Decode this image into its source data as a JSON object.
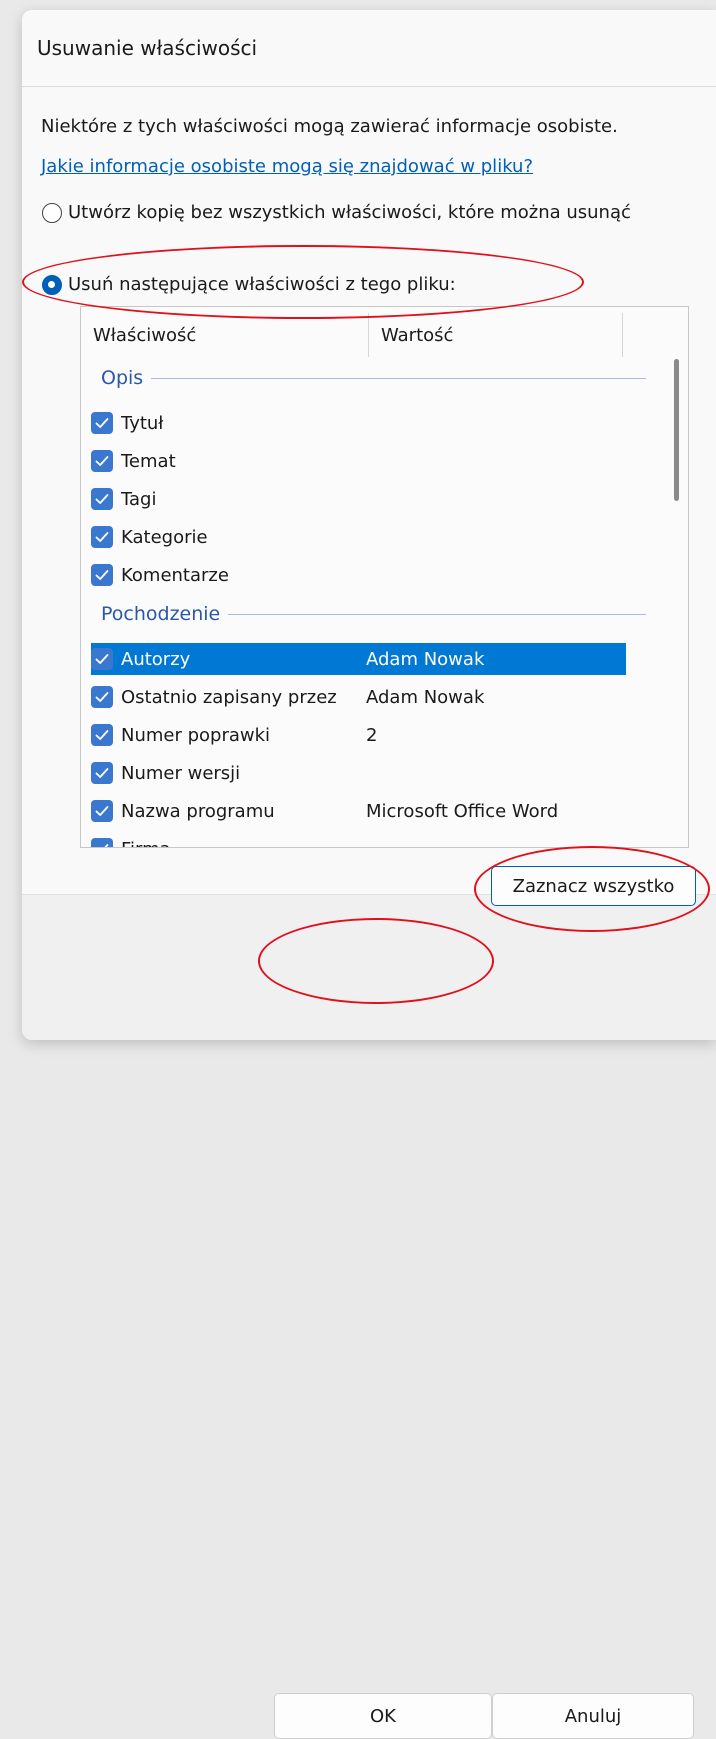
{
  "dialog": {
    "title": "Usuwanie właściwości",
    "info_text": "Niektóre z tych właściwości mogą zawierać informacje osobiste.",
    "link_text": "Jakie informacje osobiste mogą się znajdować w pliku?",
    "option_copy": "Utwórz kopię bez wszystkich właściwości, które można usunąć",
    "option_remove": "Usuń następujące właściwości z tego pliku:",
    "selected_option": "remove"
  },
  "list": {
    "col_property": "Właściwość",
    "col_value": "Wartość",
    "groups": [
      {
        "name": "Opis",
        "items": [
          {
            "label": "Tytuł",
            "value": "",
            "checked": true
          },
          {
            "label": "Temat",
            "value": "",
            "checked": true
          },
          {
            "label": "Tagi",
            "value": "",
            "checked": true
          },
          {
            "label": "Kategorie",
            "value": "",
            "checked": true
          },
          {
            "label": "Komentarze",
            "value": "",
            "checked": true
          }
        ]
      },
      {
        "name": "Pochodzenie",
        "items": [
          {
            "label": "Autorzy",
            "value": "Adam Nowak",
            "checked": true,
            "selected": true
          },
          {
            "label": "Ostatnio zapisany przez",
            "value": "Adam Nowak",
            "checked": true
          },
          {
            "label": "Numer poprawki",
            "value": "2",
            "checked": true
          },
          {
            "label": "Numer wersji",
            "value": "",
            "checked": true
          },
          {
            "label": "Nazwa programu",
            "value": "Microsoft Office Word",
            "checked": true
          },
          {
            "label": "Firma",
            "value": "",
            "checked": true
          }
        ]
      }
    ]
  },
  "buttons": {
    "select_all": "Zaznacz wszystko",
    "ok": "OK",
    "cancel": "Anuluj"
  },
  "colors": {
    "accent": "#005fb8",
    "selection": "#0078d4",
    "annotation": "#e0101c"
  }
}
